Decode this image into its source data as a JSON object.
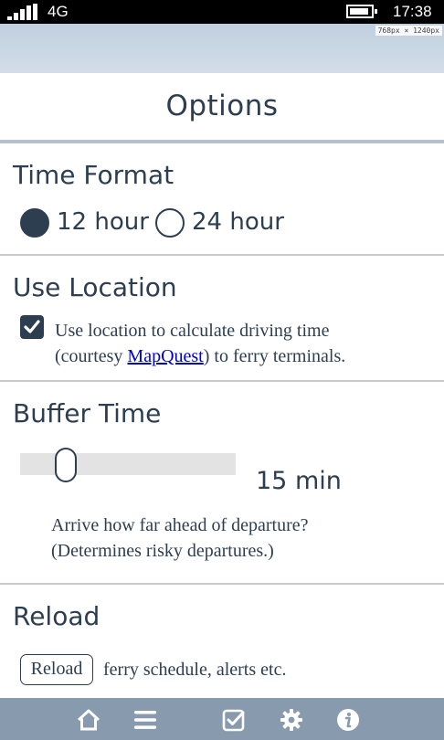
{
  "status_bar": {
    "network": "4G",
    "time": "17:38"
  },
  "size_tag": "768px × 1240px",
  "header": {
    "title": "Options"
  },
  "time_format": {
    "title": "Time Format",
    "options": [
      {
        "label": "12 hour",
        "selected": true
      },
      {
        "label": "24 hour",
        "selected": false
      }
    ]
  },
  "use_location": {
    "title": "Use Location",
    "checked": true,
    "text_1": "Use location to calculate driving time",
    "text_2a": "(courtesy ",
    "link": "MapQuest",
    "text_2b": ") to ferry terminals."
  },
  "buffer_time": {
    "title": "Buffer Time",
    "value_label": "15 min",
    "slider_value_fraction": 0.18,
    "desc_1": "Arrive how far ahead of departure?",
    "desc_2": "(Determines risky departures.)"
  },
  "reload": {
    "title": "Reload",
    "button": "Reload",
    "text": " ferry schedule, alerts etc."
  },
  "bottom_nav": [
    {
      "icon": "home-icon"
    },
    {
      "icon": "menu-icon"
    },
    {
      "icon": "checkbox-icon"
    },
    {
      "icon": "gear-icon"
    },
    {
      "icon": "info-icon"
    }
  ],
  "colors": {
    "primary": "#2d3e50",
    "nav_bar": "#889aae",
    "link": "#0000cc",
    "slider_track": "#e3e3e3"
  }
}
